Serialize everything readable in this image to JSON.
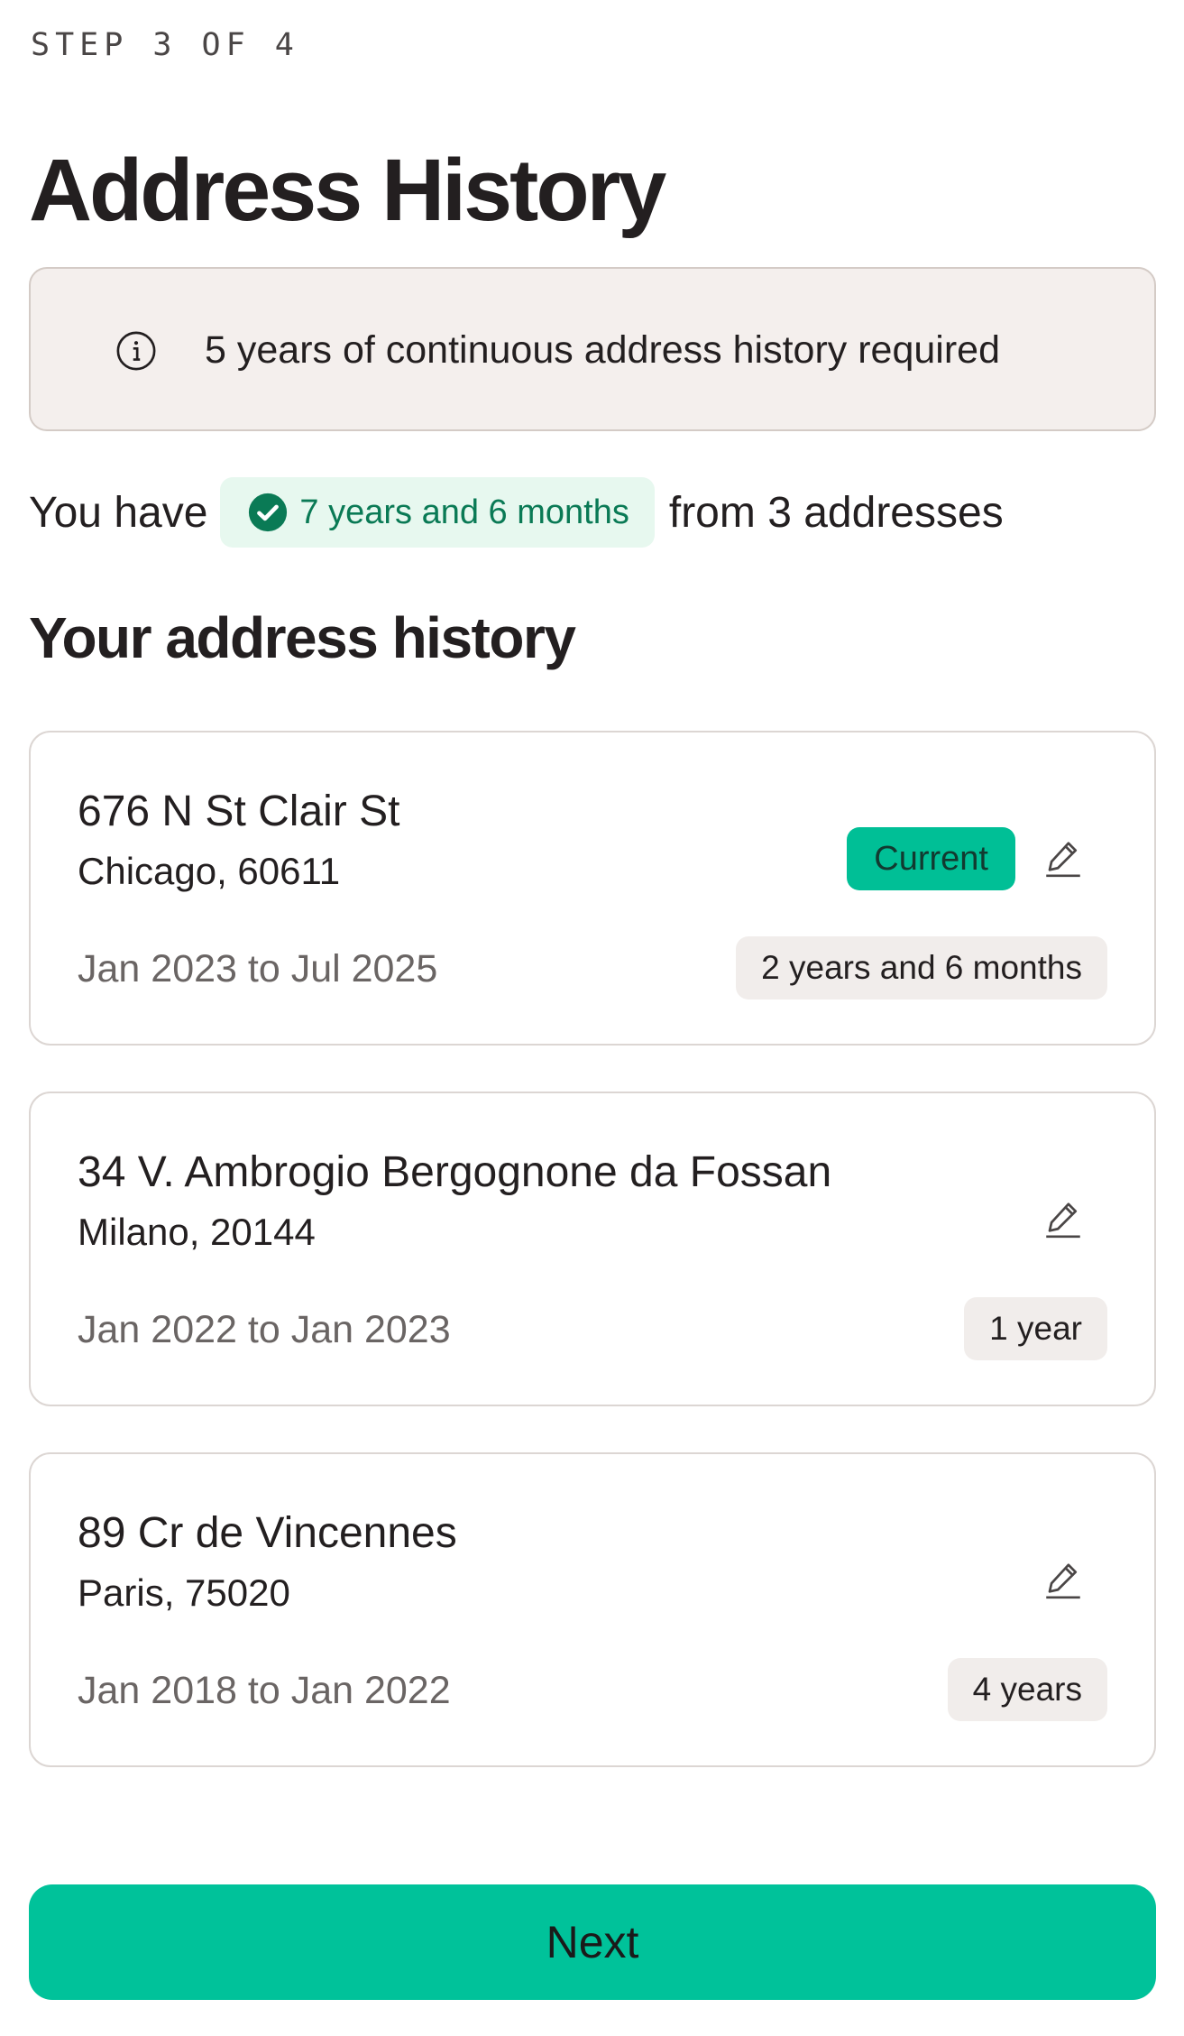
{
  "header": {
    "step": "STEP 3 OF 4",
    "title": "Address History"
  },
  "notice": {
    "icon": "info-circle-icon",
    "text": "5 years of continuous address history required"
  },
  "summary": {
    "prefix": "You have",
    "total": "7 years and 6 months",
    "suffix": "from 3 addresses",
    "icon": "check-circle-icon"
  },
  "section": {
    "title": "Your address history"
  },
  "addresses": [
    {
      "street": "676 N St Clair St",
      "city": "Chicago, 60611",
      "dates": "Jan 2023 to Jul 2025",
      "duration": "2 years and 6 months",
      "badge": "Current",
      "edit_icon": "pencil-icon"
    },
    {
      "street": "34 V. Ambrogio Bergognone da Fossan",
      "city": "Milano, 20144",
      "dates": "Jan 2022 to Jan 2023",
      "duration": "1 year",
      "edit_icon": "pencil-icon"
    },
    {
      "street": "89 Cr de Vincennes",
      "city": "Paris, 75020",
      "dates": "Jan 2018 to Jan 2022",
      "duration": "4 years",
      "edit_icon": "pencil-icon"
    }
  ],
  "footer": {
    "next_label": "Next"
  },
  "colors": {
    "accent": "#00c29a",
    "notice_bg": "#f4efed",
    "success_bg": "#e7f8ef",
    "success_text": "#0a7a55"
  }
}
